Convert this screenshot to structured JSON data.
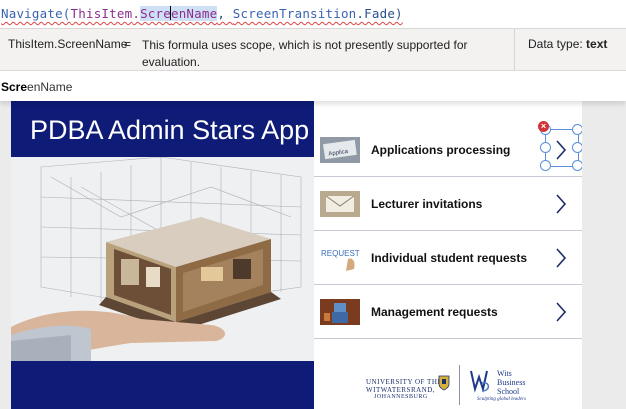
{
  "formula_bar": {
    "tokens": [
      "Navigate(",
      "ThisItem",
      ".",
      "Scre",
      "enName",
      ", ",
      "ScreenTransition",
      ".Fade)"
    ]
  },
  "intellisense": {
    "expression": "ThisItem.ScreenName",
    "equals": "=",
    "message": "This formula uses scope, which is not presently supported for evaluation.",
    "data_type_label": "Data type:",
    "data_type_value": "text"
  },
  "suggestion": {
    "match": "Scre",
    "rest": "enName"
  },
  "app": {
    "title": "PDBA Admin Stars App",
    "items": [
      {
        "label": "Applications processing",
        "thumb": "applications-icon"
      },
      {
        "label": "Lecturer invitations",
        "thumb": "envelope-icon"
      },
      {
        "label": "Individual student requests",
        "thumb": "request-icon"
      },
      {
        "label": "Management requests",
        "thumb": "robot-icon"
      }
    ],
    "footer": {
      "university_line1": "UNIVERSITY OF THE",
      "university_line2": "WITWATERSRAND,",
      "university_line3": "JOHANNESBURG",
      "school_line1": "Wits",
      "school_line2": "Business",
      "school_line3": "School",
      "school_tagline": "Sculpting global leaders"
    }
  },
  "colors": {
    "brand_navy": "#0e1c77",
    "error_red": "#d13438",
    "selection_blue": "#5b8fd9"
  }
}
